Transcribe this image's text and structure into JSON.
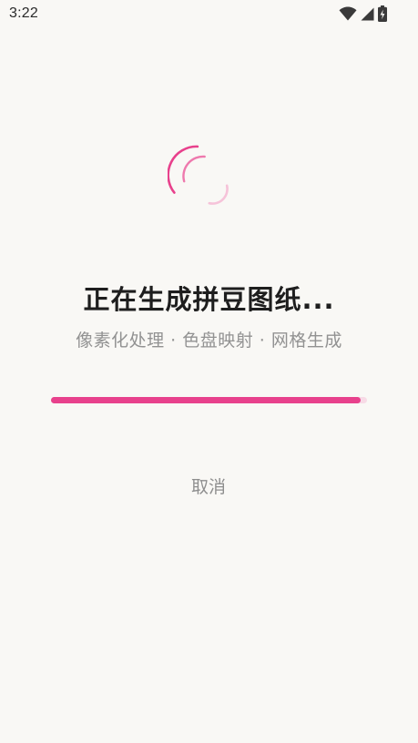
{
  "status_bar": {
    "time": "3:22",
    "icons": [
      "wifi-icon",
      "cellular-signal-icon",
      "battery-charging-icon"
    ]
  },
  "loading": {
    "title": "正在生成拼豆图纸...",
    "subtitle": "像素化处理 · 色盘映射 · 网格生成",
    "progress": 0.98,
    "accent_color": "#e8418c",
    "track_color": "#f7dbe6"
  },
  "actions": {
    "cancel_label": "取消"
  }
}
